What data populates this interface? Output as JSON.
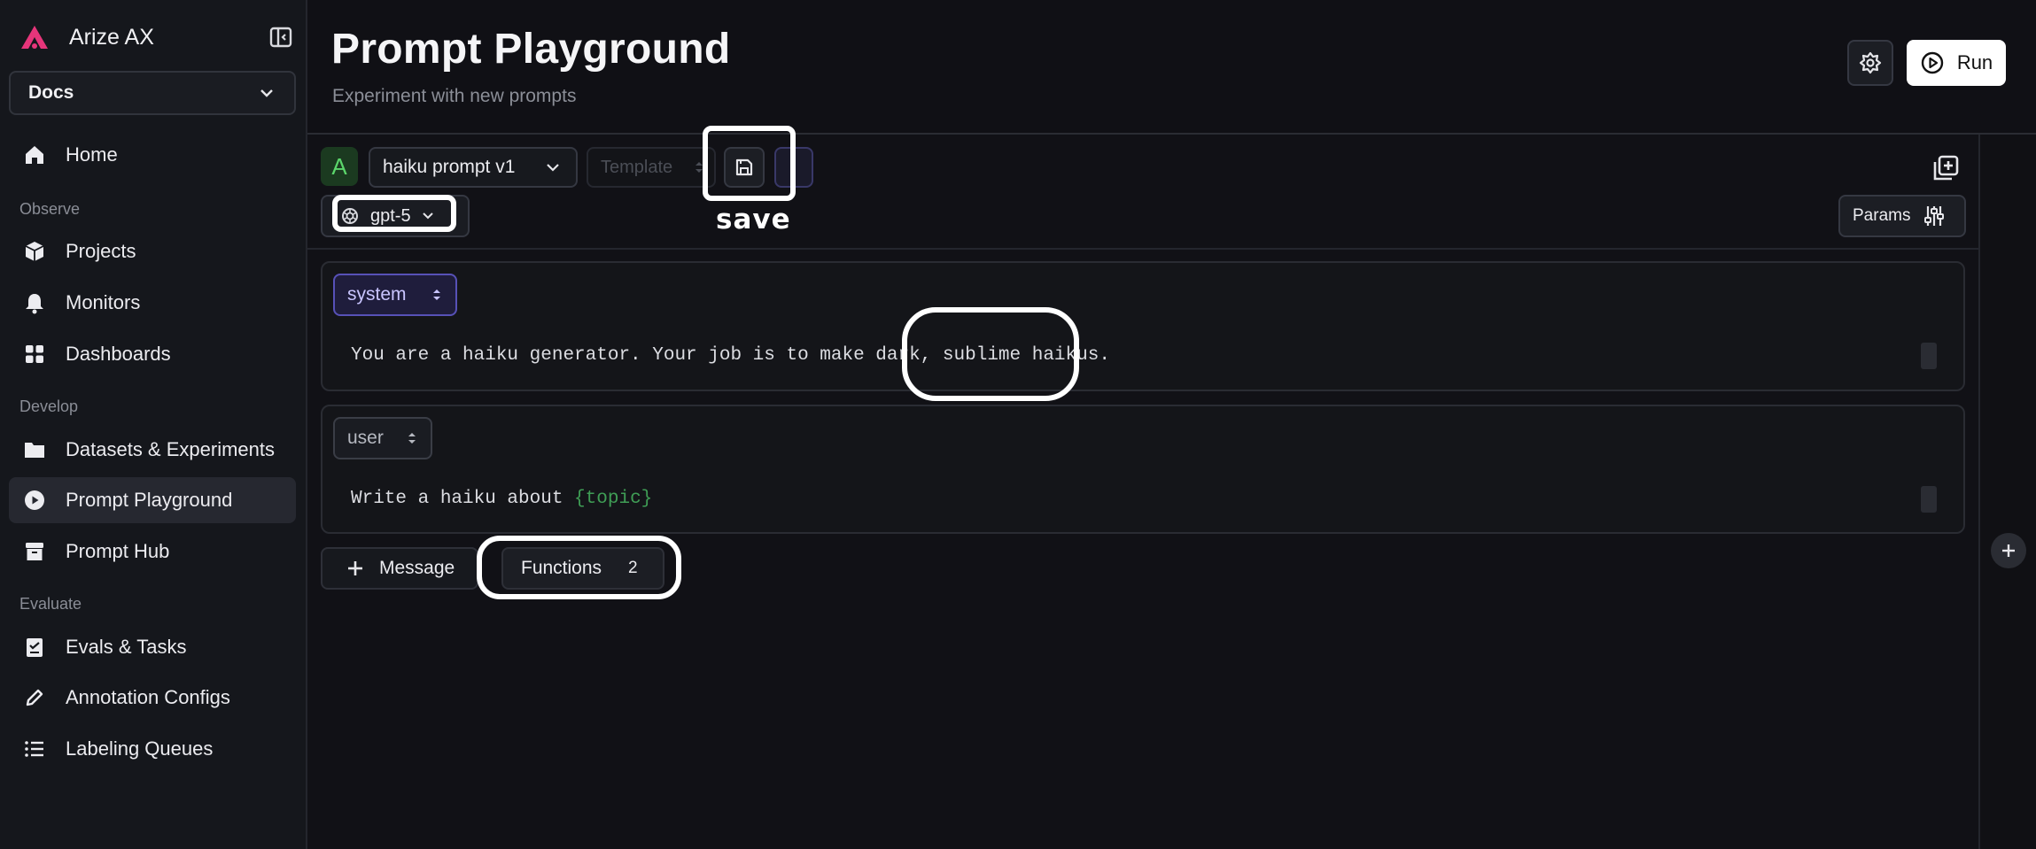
{
  "sidebar": {
    "brand": "Arize AX",
    "space": "Docs",
    "items": [
      {
        "label": "Home"
      },
      {
        "label": "Projects"
      },
      {
        "label": "Monitors"
      },
      {
        "label": "Dashboards"
      },
      {
        "label": "Datasets & Experiments"
      },
      {
        "label": "Prompt Playground",
        "active": true
      },
      {
        "label": "Prompt Hub"
      },
      {
        "label": "Evals & Tasks"
      },
      {
        "label": "Annotation Configs"
      },
      {
        "label": "Labeling Queues"
      }
    ],
    "sections": [
      "Observe",
      "Develop",
      "Evaluate"
    ]
  },
  "header": {
    "title": "Prompt Playground",
    "subtitle": "Experiment with new prompts",
    "run_label": "Run"
  },
  "prompt": {
    "letter": "A",
    "name": "haiku prompt v1",
    "template_placeholder": "Template",
    "model": "gpt-5",
    "params_label": "Params",
    "messages": [
      {
        "role": "system",
        "text": "You are a haiku generator. Your job is to make dark, sublime haikus."
      },
      {
        "role": "user",
        "text_before": "Write a haiku about ",
        "brace_open": "{",
        "variable": "topic",
        "brace_close": "}"
      }
    ],
    "add_message_label": "Message",
    "functions_label": "Functions",
    "functions_count": "2"
  },
  "annotations": {
    "save_caption": "save"
  },
  "colors": {
    "brand": "#e6357a",
    "system_role": "#5751b7",
    "variable": "#3f9d55",
    "letter_badge": "#5bd66b"
  },
  "icons": [
    "arize-logo-icon",
    "sidebar-collapse-icon",
    "chevron-down-icon",
    "home-icon",
    "cube-icon",
    "bell-icon",
    "grid-icon",
    "folder-icon",
    "play-circle-icon",
    "archive-icon",
    "checklist-icon",
    "pencil-icon",
    "list-icon",
    "settings-flower-icon",
    "play-icon",
    "save-icon",
    "openai-icon",
    "copy-add-icon",
    "sliders-icon",
    "plus-icon",
    "up-down-chevron-icon"
  ]
}
